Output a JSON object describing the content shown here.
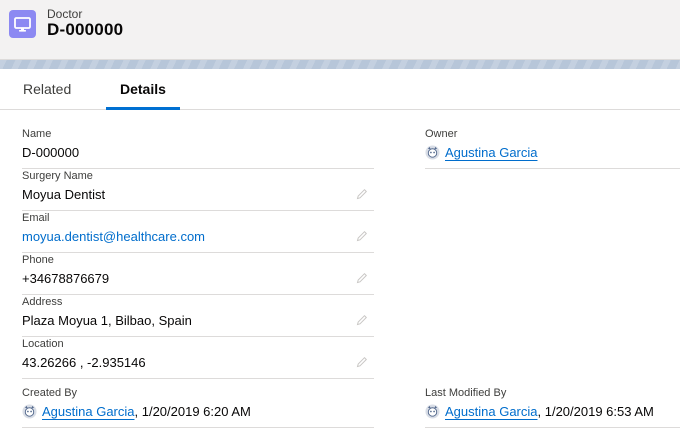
{
  "header": {
    "object_type": "Doctor",
    "record_name": "D-000000",
    "icon": "monitor-icon",
    "icon_color": "#8c89f2"
  },
  "tabs": [
    {
      "label": "Related",
      "active": false
    },
    {
      "label": "Details",
      "active": true
    }
  ],
  "fields": {
    "name": {
      "label": "Name",
      "value": "D-000000"
    },
    "owner": {
      "label": "Owner",
      "value": "Agustina Garcia"
    },
    "surgery_name": {
      "label": "Surgery Name",
      "value": "Moyua Dentist"
    },
    "email": {
      "label": "Email",
      "value": "moyua.dentist@healthcare.com"
    },
    "phone": {
      "label": "Phone",
      "value": "+34678876679"
    },
    "address": {
      "label": "Address",
      "value": "Plaza Moyua 1, Bilbao, Spain"
    },
    "location": {
      "label": "Location",
      "value": "43.26266 , -2.935146"
    },
    "created_by": {
      "label": "Created By",
      "user": "Agustina Garcia",
      "date": ", 1/20/2019 6:20 AM"
    },
    "last_modified_by": {
      "label": "Last Modified By",
      "user": "Agustina Garcia",
      "date": ", 1/20/2019 6:53 AM"
    }
  },
  "colors": {
    "link": "#006dcc",
    "tab_active_underline": "#0070d2",
    "header_bg": "#f3f2f2"
  }
}
